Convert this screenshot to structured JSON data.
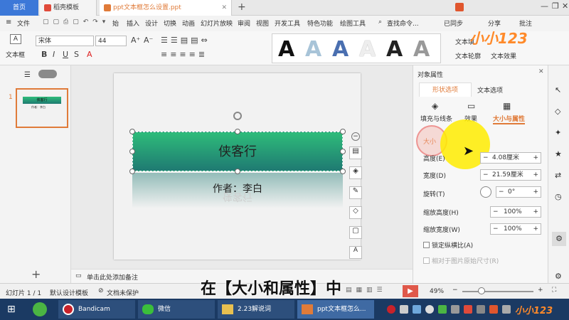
{
  "tabs": {
    "home": "首页",
    "template": "稻壳模板",
    "document": "ppt文本框怎么设置.ppt",
    "add": "+"
  },
  "menu": {
    "file": "文件",
    "items": [
      "始",
      "插入",
      "设计",
      "切换",
      "动画",
      "幻灯片放映",
      "审阅",
      "视图",
      "开发工具",
      "特色功能",
      "绘图工具"
    ],
    "search": "查找命令...",
    "sync": "已同步",
    "share": "分享",
    "comment": "批注"
  },
  "ribbon": {
    "textbox_label": "文本框",
    "font_name": "宋体",
    "font_size": "44",
    "text_fill": "文本填",
    "text_outline": "文本轮廓",
    "text_effect": "文本效果"
  },
  "thumb": {
    "number": "1",
    "title": "侠客行",
    "subtitle": "作者：李白"
  },
  "slide": {
    "title": "侠客行",
    "subtitle": "作者：李白",
    "reflection": "侠客行"
  },
  "notes_placeholder": "单击此处添加备注",
  "panel": {
    "title": "对象属性",
    "tab_shape": "形状选项",
    "tab_text": "文本选项",
    "sub_fill": "填充与线条",
    "sub_effect": "效果",
    "sub_size": "大小与属性",
    "section": "大小",
    "height_label": "高度(E)",
    "height_value": "4.08厘米",
    "width_label": "宽度(D)",
    "width_value": "21.59厘米",
    "rotate_label": "旋转(T)",
    "rotate_value": "0°",
    "scale_h_label": "缩放高度(H)",
    "scale_h_value": "100%",
    "scale_w_label": "缩放宽度(W)",
    "scale_w_value": "100%",
    "lock_ratio": "锁定纵横比(A)",
    "relative_original": "相对于图片原始尺寸(R)"
  },
  "status": {
    "slide_count": "幻灯片 1 / 1",
    "template": "默认设计模板",
    "protection": "文档未保护",
    "zoom": "49%"
  },
  "subtitle_caption": "在【大小和属性】中",
  "watermark": "小小123",
  "taskbar": {
    "bandicam": "Bandicam",
    "wechat": "微信",
    "folder": "2.23解说词",
    "wps": "ppt文本框怎么..."
  },
  "colors": {
    "accent_blue": "#3c78d8",
    "tab_active_orange": "#e07b39",
    "taskbar": "#1b3a63",
    "green_top": "#2ebc7a",
    "green_bottom": "#1f7a72"
  }
}
